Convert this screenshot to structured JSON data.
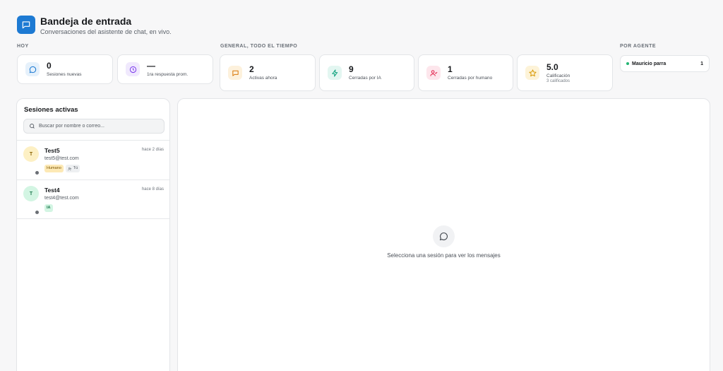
{
  "header": {
    "title": "Bandeja de entrada",
    "subtitle": "Conversaciones del asistente de chat, en vivo.",
    "icon": "chat-icon"
  },
  "sections": {
    "today": "HOY",
    "general": "GENERAL, TODO EL TIEMPO",
    "by_agent": "POR AGENTE"
  },
  "stats": {
    "new_sessions": {
      "value": "0",
      "label": "Sesiones nuevas",
      "icon": "chat-bubble-icon",
      "color": "#1d7ad3"
    },
    "first_response": {
      "value": "—",
      "label": "1ra respuesta prom.",
      "icon": "clock-icon",
      "color": "#7c3aed"
    },
    "active_now": {
      "value": "2",
      "label": "Activas ahora",
      "icon": "chat-square-icon",
      "color": "#d97706"
    },
    "closed_ai": {
      "value": "9",
      "label": "Cerradas por IA",
      "icon": "bolt-icon",
      "color": "#10a37f"
    },
    "closed_human": {
      "value": "1",
      "label": "Cerradas por humano",
      "icon": "user-check-icon",
      "color": "#e11d48"
    },
    "rating": {
      "value": "5.0",
      "label": "Calificación",
      "sub": "3 calificados",
      "icon": "star-icon",
      "color": "#d99a06"
    }
  },
  "agents": [
    {
      "name": "Mauricio parra",
      "count": "1",
      "status_color": "#22b573"
    }
  ],
  "sessions_panel": {
    "title": "Sesiones activas",
    "search_placeholder": "Buscar por nombre o correo...",
    "items": [
      {
        "initial": "T",
        "name": "Test5",
        "email": "test5@test.com",
        "time": "hace 2 días",
        "tags": [
          "Humano",
          "Tú"
        ],
        "avatar_bg": "#fdf0c4",
        "avatar_fg": "#8a6200"
      },
      {
        "initial": "T",
        "name": "Test4",
        "email": "test4@test.com",
        "time": "hace 8 días",
        "tags": [
          "IA"
        ],
        "avatar_bg": "#d3f5e3",
        "avatar_fg": "#1f7a4f"
      }
    ]
  },
  "chat_panel": {
    "empty_text": "Selecciona una sesión para ver los mensajes",
    "icon": "chat-bubble-icon"
  }
}
